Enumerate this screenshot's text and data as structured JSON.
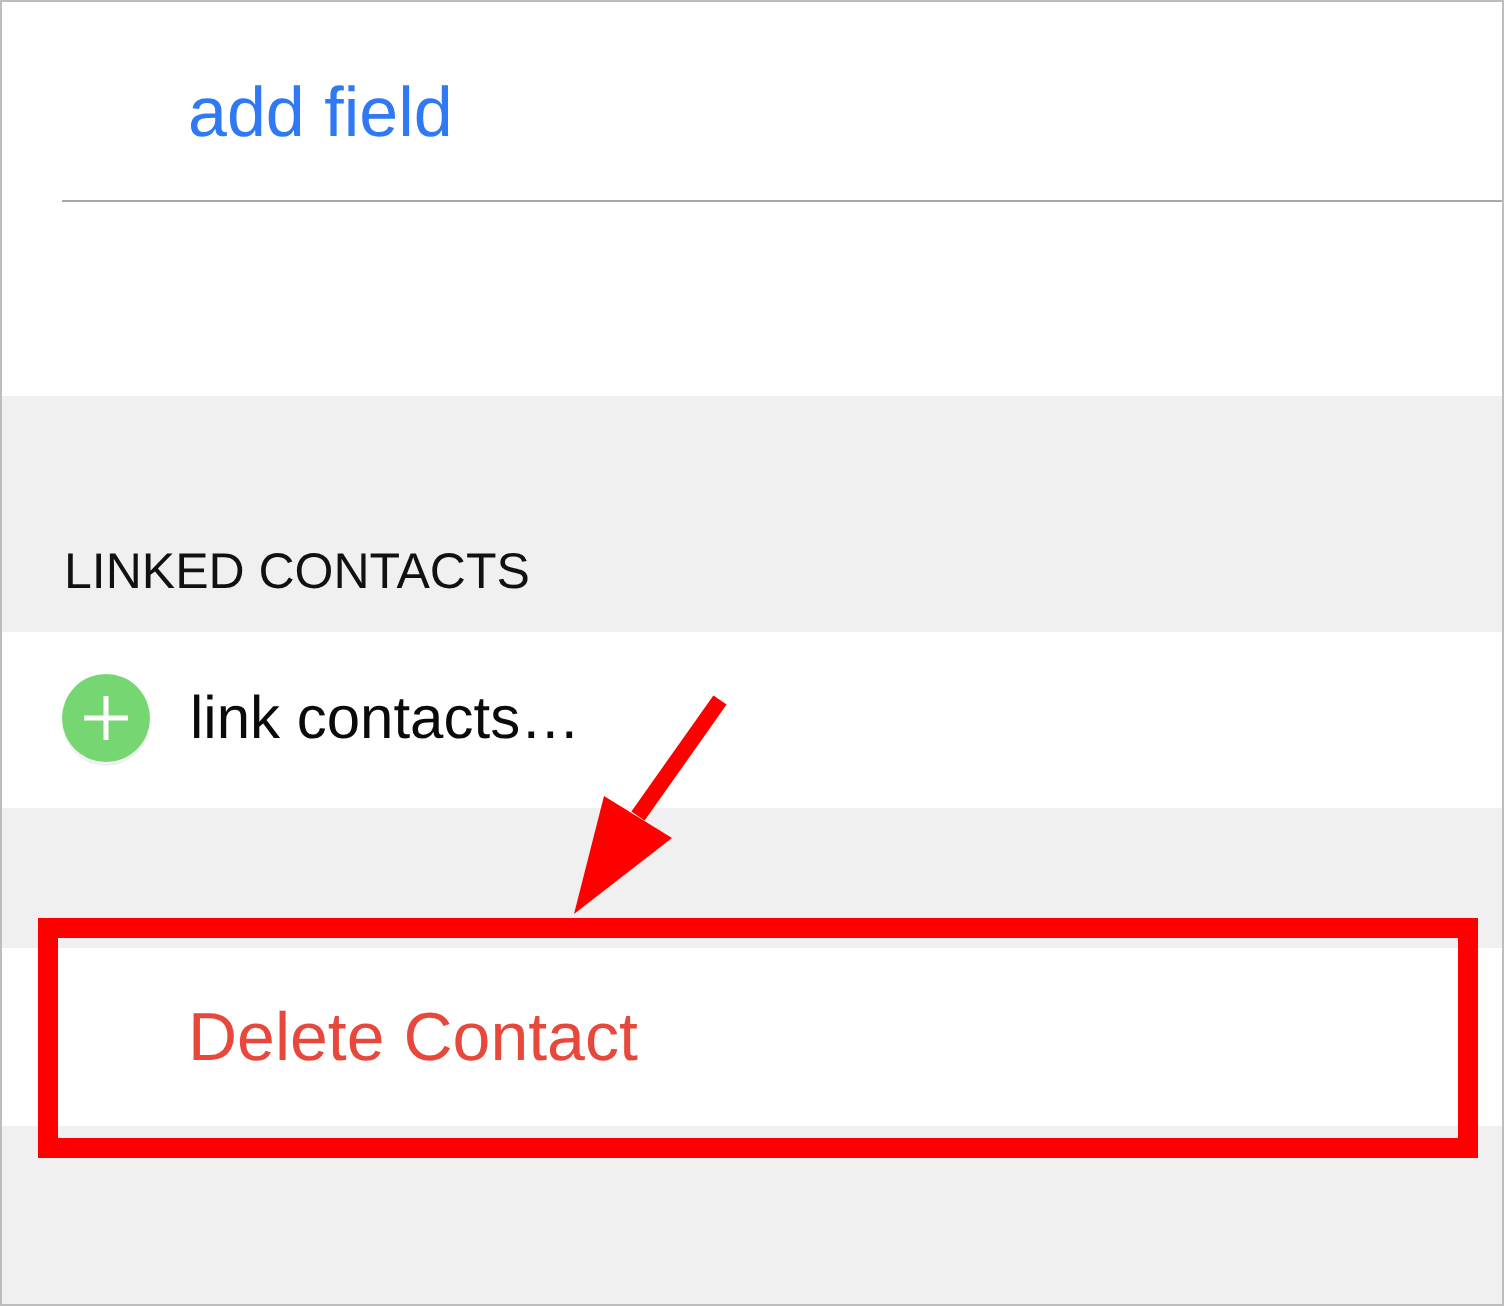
{
  "fields_section": {
    "add_field": "add field"
  },
  "linked_contacts": {
    "header": "LINKED CONTACTS",
    "items": [
      {
        "label": "link contacts…"
      }
    ]
  },
  "delete_button": {
    "label": "Delete Contact",
    "highlighted": true
  }
}
